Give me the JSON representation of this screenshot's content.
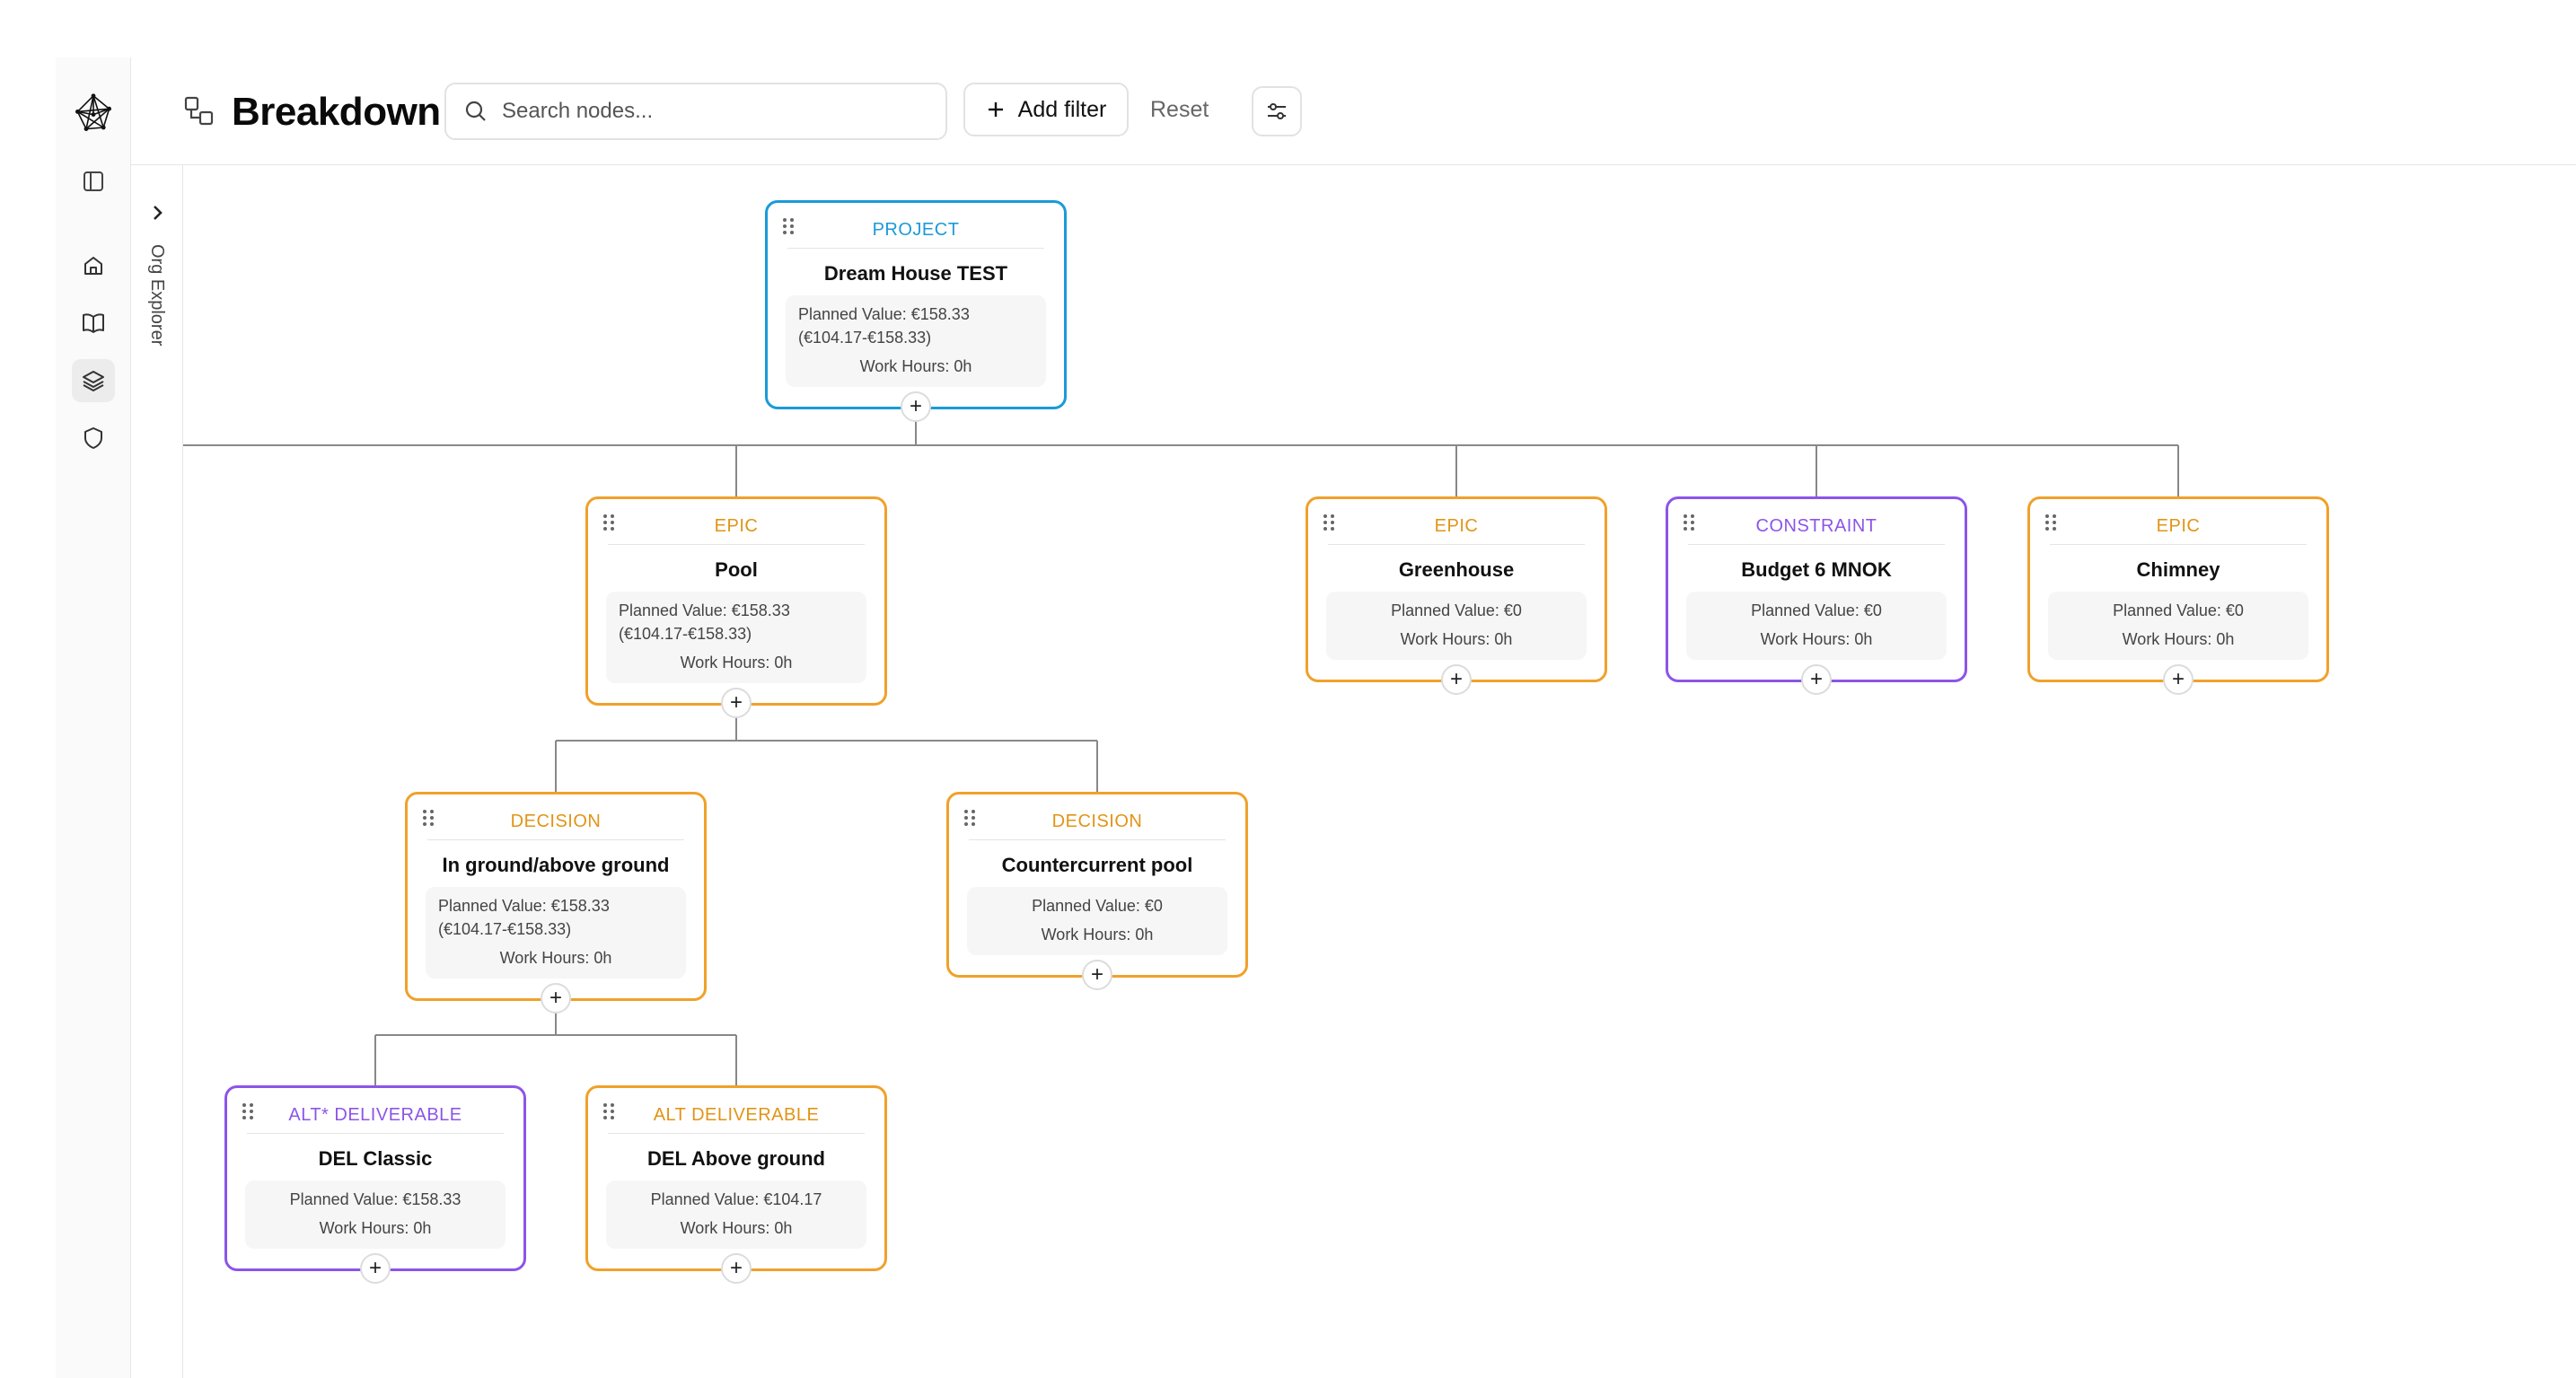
{
  "rail": {
    "logo": "network-logo-icon",
    "items": [
      {
        "name": "sidebar-toggle-icon"
      },
      {
        "name": "home-icon"
      },
      {
        "name": "book-icon"
      },
      {
        "name": "layers-icon"
      },
      {
        "name": "shield-icon"
      }
    ]
  },
  "explorer": {
    "label": "Org Explorer"
  },
  "header": {
    "title": "Breakdown",
    "search_placeholder": "Search nodes...",
    "add_filter_label": "Add filter",
    "reset_label": "Reset"
  },
  "nodes": {
    "project": {
      "type": "PROJECT",
      "name": "Dream House TEST",
      "planned_value": "Planned Value: €158.33 (€104.17-€158.33)",
      "work_hours": "Work Hours: 0h",
      "add": "+"
    },
    "pool": {
      "type": "EPIC",
      "name": "Pool",
      "planned_value": "Planned Value: €158.33 (€104.17-€158.33)",
      "work_hours": "Work Hours: 0h",
      "add": "+"
    },
    "greenhouse": {
      "type": "EPIC",
      "name": "Greenhouse",
      "planned_value": "Planned Value: €0",
      "work_hours": "Work Hours: 0h",
      "add": "+"
    },
    "budget": {
      "type": "CONSTRAINT",
      "name": "Budget 6 MNOK",
      "planned_value": "Planned Value: €0",
      "work_hours": "Work Hours: 0h",
      "add": "+"
    },
    "chimney": {
      "type": "EPIC",
      "name": "Chimney",
      "planned_value": "Planned Value: €0",
      "work_hours": "Work Hours: 0h",
      "add": "+"
    },
    "inground": {
      "type": "DECISION",
      "name": "In ground/above ground",
      "planned_value": "Planned Value: €158.33 (€104.17-€158.33)",
      "work_hours": "Work Hours: 0h",
      "add": "+"
    },
    "countercurrent": {
      "type": "DECISION",
      "name": "Countercurrent pool",
      "planned_value": "Planned Value: €0",
      "work_hours": "Work Hours: 0h",
      "add": "+"
    },
    "delclassic": {
      "type": "ALT* DELIVERABLE",
      "name": "DEL Classic",
      "planned_value": "Planned Value: €158.33",
      "work_hours": "Work Hours: 0h",
      "add": "+"
    },
    "delabove": {
      "type": "ALT DELIVERABLE",
      "name": "DEL Above ground",
      "planned_value": "Planned Value: €104.17",
      "work_hours": "Work Hours: 0h",
      "add": "+"
    }
  },
  "colors": {
    "project": "#1a9ad9",
    "orange": "#f0a12a",
    "purple": "#8c55e8"
  }
}
